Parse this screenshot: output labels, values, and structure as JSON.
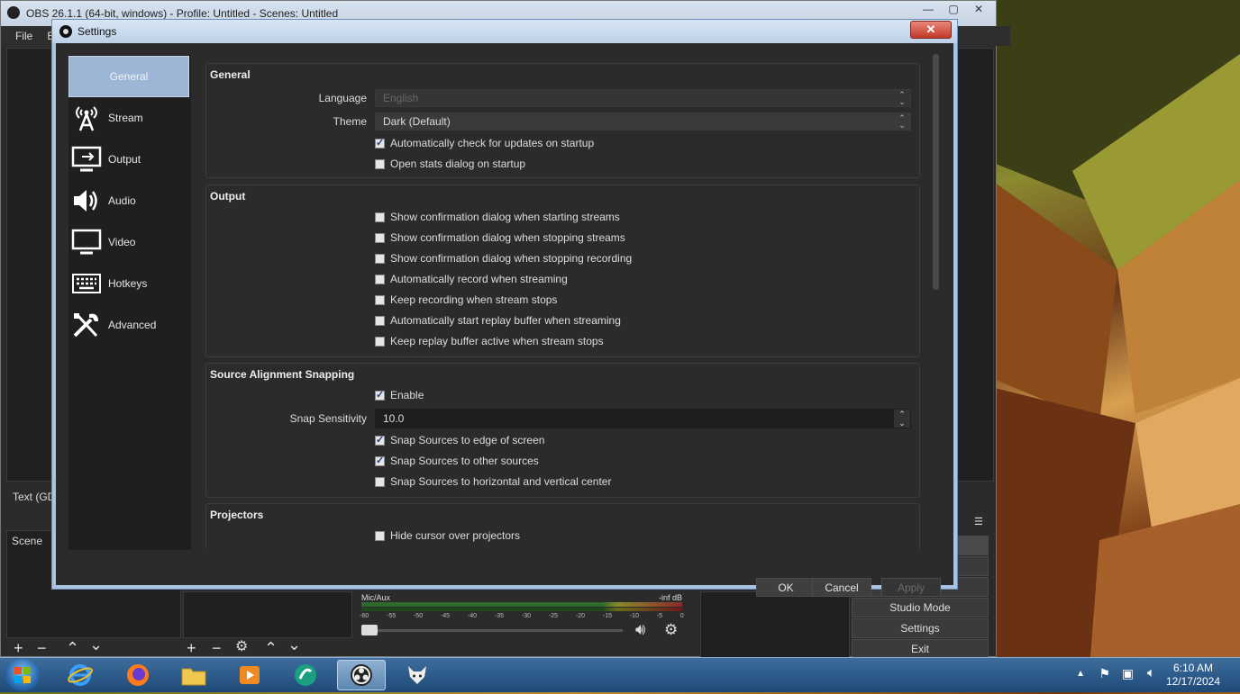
{
  "obs_window": {
    "title": "OBS 26.1.1 (64-bit, windows) - Profile: Untitled - Scenes: Untitled",
    "menu": [
      "File",
      "E"
    ],
    "sources_label": "Text (GD",
    "scene_label": "Scene",
    "controls": [
      "Studio Mode",
      "Settings",
      "Exit"
    ],
    "mixer": {
      "track_name": "Mic/Aux",
      "level_text": "-inf dB",
      "scale": [
        "-60",
        "-55",
        "-50",
        "-45",
        "-40",
        "-35",
        "-30",
        "-25",
        "-20",
        "-15",
        "-10",
        "-5",
        "0"
      ]
    }
  },
  "dialog": {
    "title": "Settings",
    "close_glyph": "✕",
    "sidebar": [
      {
        "label": "General",
        "icon": "gear-icon",
        "active": true
      },
      {
        "label": "Stream",
        "icon": "antenna-icon",
        "active": false
      },
      {
        "label": "Output",
        "icon": "monitor-output-icon",
        "active": false
      },
      {
        "label": "Audio",
        "icon": "speaker-icon",
        "active": false
      },
      {
        "label": "Video",
        "icon": "monitor-icon",
        "active": false
      },
      {
        "label": "Hotkeys",
        "icon": "keyboard-icon",
        "active": false
      },
      {
        "label": "Advanced",
        "icon": "tools-icon",
        "active": false
      }
    ],
    "general": {
      "title": "General",
      "language_label": "Language",
      "language_value": "English",
      "theme_label": "Theme",
      "theme_value": "Dark (Default)",
      "check_updates": "Automatically check for updates on startup",
      "check_updates_checked": true,
      "open_stats": "Open stats dialog on startup",
      "open_stats_checked": false
    },
    "output": {
      "title": "Output",
      "options": [
        {
          "label": "Show confirmation dialog when starting streams",
          "checked": false
        },
        {
          "label": "Show confirmation dialog when stopping streams",
          "checked": false
        },
        {
          "label": "Show confirmation dialog when stopping recording",
          "checked": false
        },
        {
          "label": "Automatically record when streaming",
          "checked": false
        },
        {
          "label": "Keep recording when stream stops",
          "checked": false
        },
        {
          "label": "Automatically start replay buffer when streaming",
          "checked": false
        },
        {
          "label": "Keep replay buffer active when stream stops",
          "checked": false
        }
      ]
    },
    "snapping": {
      "title": "Source Alignment Snapping",
      "enable": "Enable",
      "enable_checked": true,
      "sensitivity_label": "Snap Sensitivity",
      "sensitivity_value": "10.0",
      "edge": "Snap Sources to edge of screen",
      "edge_checked": true,
      "other": "Snap Sources to other sources",
      "other_checked": true,
      "center": "Snap Sources to horizontal and vertical center",
      "center_checked": false
    },
    "projectors": {
      "title": "Projectors",
      "hide_cursor": "Hide cursor over projectors",
      "hide_cursor_checked": false
    },
    "buttons": {
      "ok": "OK",
      "cancel": "Cancel",
      "apply": "Apply"
    }
  },
  "taskbar": {
    "time": "6:10 AM",
    "date": "12/17/2024"
  }
}
